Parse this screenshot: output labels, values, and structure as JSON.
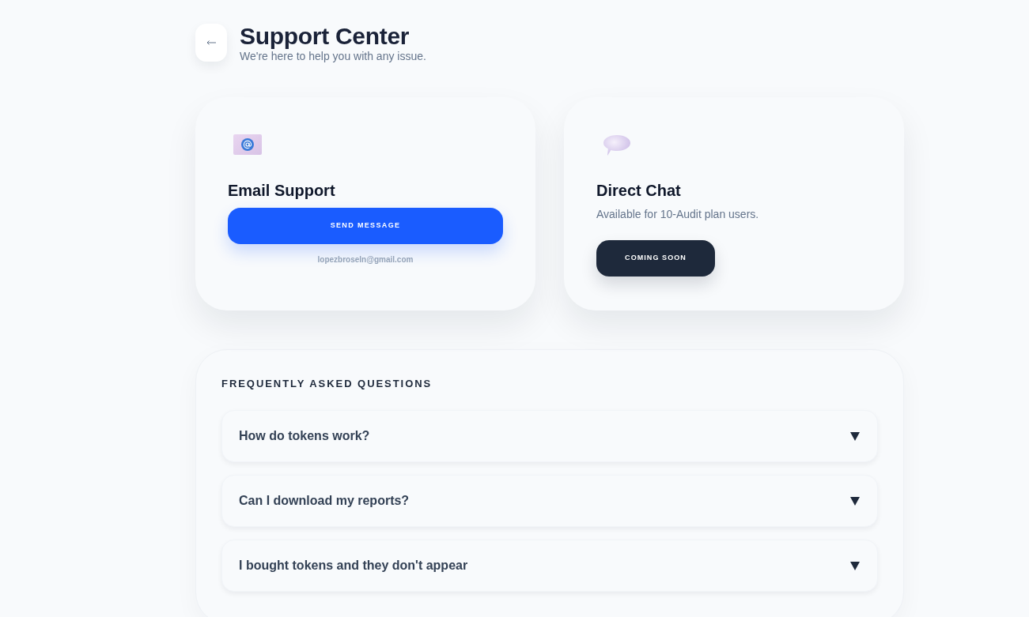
{
  "header": {
    "title": "Support Center",
    "subtitle": "We're here to help you with any issue."
  },
  "cards": [
    {
      "kind": "email",
      "title": "Email Support",
      "button": {
        "label": "SEND MESSAGE"
      },
      "note": "lopezbroseln@gmail.com"
    },
    {
      "kind": "chat",
      "title": "Direct Chat",
      "description": "Available for 10-Audit plan users.",
      "button": {
        "label": "COMING SOON"
      }
    }
  ],
  "faq": {
    "heading": "FREQUENTLY ASKED QUESTIONS",
    "items": [
      {
        "question": "How do tokens work?",
        "expanded": false
      },
      {
        "question": "Can I download my reports?",
        "expanded": false
      },
      {
        "question": "I bought tokens and they don't appear",
        "expanded": false
      }
    ]
  }
}
